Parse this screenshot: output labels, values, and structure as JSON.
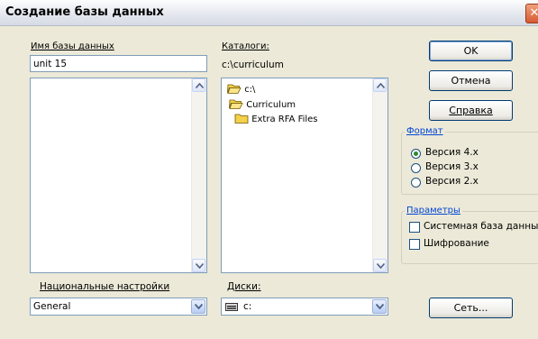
{
  "dialog": {
    "title": "Создание базы данных",
    "close_glyph": "✕"
  },
  "db_name": {
    "label": "Имя базы данных",
    "value": "unit 15"
  },
  "catalogs": {
    "label": "Каталоги:",
    "current_path": "c:\\curriculum",
    "tree": [
      "c:\\",
      "Curriculum",
      "Extra RFA Files"
    ]
  },
  "buttons": {
    "ok": "OK",
    "cancel": "Отмена",
    "help": "Справка",
    "network": "Сеть..."
  },
  "format": {
    "legend": "Формат",
    "options": [
      "Версия 4.x",
      "Версия 3.x",
      "Версия 2.x"
    ],
    "selected": "Версия 4.x"
  },
  "params": {
    "legend": "Параметры",
    "options": [
      "Системная база данных",
      "Шифрование"
    ]
  },
  "national": {
    "label": "Национальные настройки",
    "value": "General"
  },
  "drives": {
    "label": "Диски:",
    "value": "c:"
  },
  "icons": {
    "close": "close-icon",
    "folder_open": "folder-open-icon",
    "folder_closed": "folder-icon",
    "drive": "drive-icon",
    "scroll_up": "scroll-up-icon",
    "scroll_down": "scroll-down-icon",
    "dropdown": "chevron-down-icon"
  },
  "colors": {
    "dialog_bg": "#ece9d8",
    "accent_link": "#0046d5",
    "close_button": "#d55a30",
    "folder_yellow": "#f5d04a",
    "radio_selected": "#2c8a2c"
  }
}
